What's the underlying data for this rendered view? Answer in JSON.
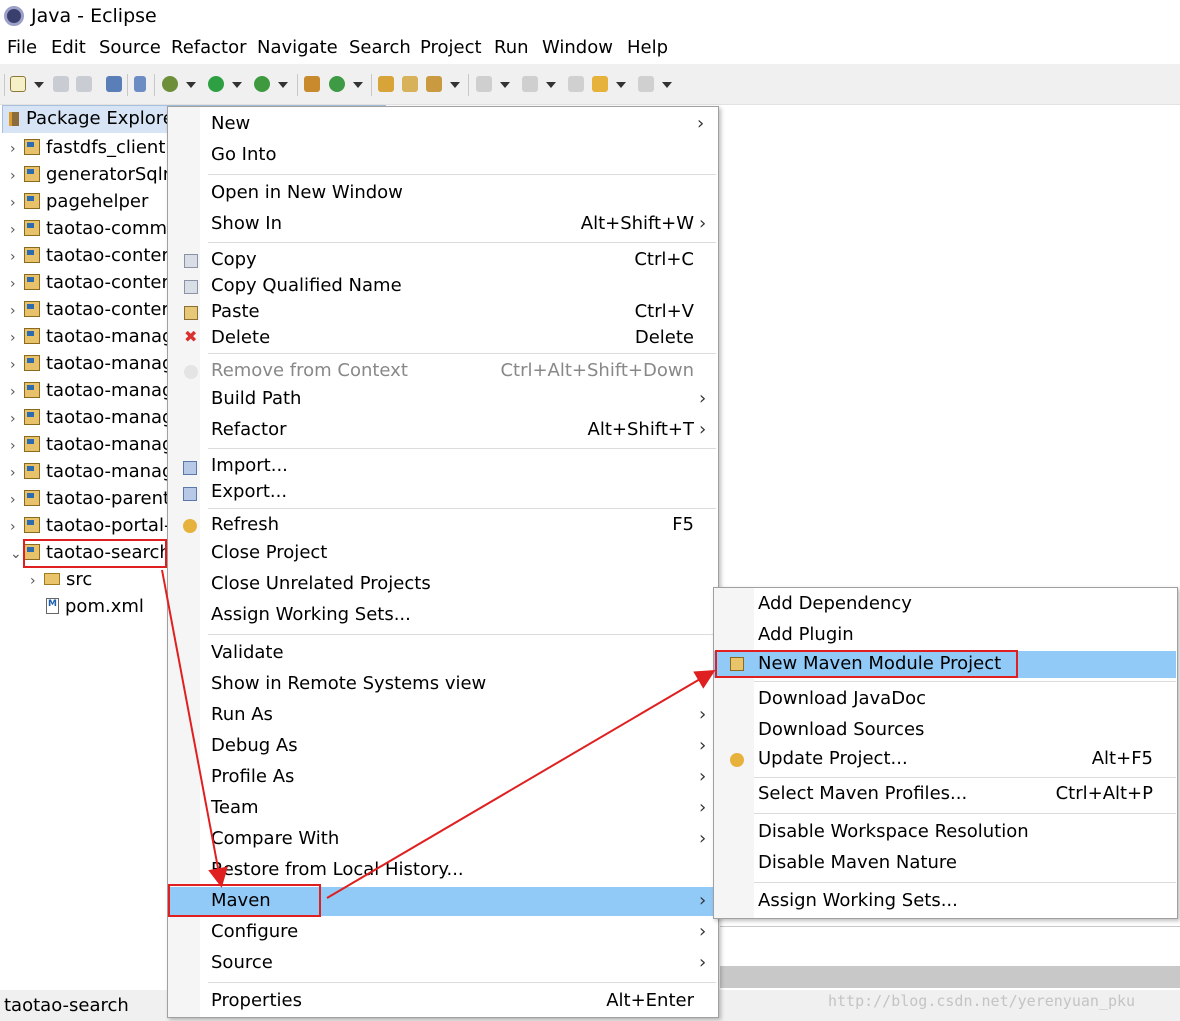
{
  "window": {
    "title": "Java - Eclipse"
  },
  "menubar": [
    "File",
    "Edit",
    "Source",
    "Refactor",
    "Navigate",
    "Search",
    "Project",
    "Run",
    "Window",
    "Help"
  ],
  "package_explorer": {
    "tab_label": "Package Explore",
    "items": [
      {
        "label": "fastdfs_client"
      },
      {
        "label": "generatorSqlm"
      },
      {
        "label": "pagehelper"
      },
      {
        "label": "taotao-comm"
      },
      {
        "label": "taotao-conter"
      },
      {
        "label": "taotao-conter"
      },
      {
        "label": "taotao-conter"
      },
      {
        "label": "taotao-manag"
      },
      {
        "label": "taotao-manag"
      },
      {
        "label": "taotao-manag"
      },
      {
        "label": "taotao-manag"
      },
      {
        "label": "taotao-manag"
      },
      {
        "label": "taotao-manag"
      },
      {
        "label": "taotao-parent"
      },
      {
        "label": "taotao-portal-"
      },
      {
        "label": "taotao-search"
      }
    ],
    "children": [
      {
        "label": "src"
      },
      {
        "label": "pom.xml"
      }
    ]
  },
  "context_menu": {
    "items": [
      {
        "label": "New",
        "shortcut": ""
      },
      {
        "label": "Go Into",
        "shortcut": ""
      },
      {
        "label": "Open in New Window",
        "shortcut": ""
      },
      {
        "label": "Show In",
        "shortcut": "Alt+Shift+W"
      },
      {
        "label": "Copy",
        "shortcut": "Ctrl+C"
      },
      {
        "label": "Copy Qualified Name",
        "shortcut": ""
      },
      {
        "label": "Paste",
        "shortcut": "Ctrl+V"
      },
      {
        "label": "Delete",
        "shortcut": "Delete"
      },
      {
        "label": "Remove from Context",
        "shortcut": "Ctrl+Alt+Shift+Down"
      },
      {
        "label": "Build Path",
        "shortcut": ""
      },
      {
        "label": "Refactor",
        "shortcut": "Alt+Shift+T"
      },
      {
        "label": "Import...",
        "shortcut": ""
      },
      {
        "label": "Export...",
        "shortcut": ""
      },
      {
        "label": "Refresh",
        "shortcut": "F5"
      },
      {
        "label": "Close Project",
        "shortcut": ""
      },
      {
        "label": "Close Unrelated Projects",
        "shortcut": ""
      },
      {
        "label": "Assign Working Sets...",
        "shortcut": ""
      },
      {
        "label": "Validate",
        "shortcut": ""
      },
      {
        "label": "Show in Remote Systems view",
        "shortcut": ""
      },
      {
        "label": "Run As",
        "shortcut": ""
      },
      {
        "label": "Debug As",
        "shortcut": ""
      },
      {
        "label": "Profile As",
        "shortcut": ""
      },
      {
        "label": "Team",
        "shortcut": ""
      },
      {
        "label": "Compare With",
        "shortcut": ""
      },
      {
        "label": "Restore from Local History...",
        "shortcut": ""
      },
      {
        "label": "Maven",
        "shortcut": ""
      },
      {
        "label": "Configure",
        "shortcut": ""
      },
      {
        "label": "Source",
        "shortcut": ""
      },
      {
        "label": "Properties",
        "shortcut": "Alt+Enter"
      }
    ]
  },
  "maven_submenu": {
    "items": [
      {
        "label": "Add Dependency",
        "shortcut": ""
      },
      {
        "label": "Add Plugin",
        "shortcut": ""
      },
      {
        "label": "New Maven Module Project",
        "shortcut": ""
      },
      {
        "label": "Download JavaDoc",
        "shortcut": ""
      },
      {
        "label": "Download Sources",
        "shortcut": ""
      },
      {
        "label": "Update Project...",
        "shortcut": "Alt+F5"
      },
      {
        "label": "Select Maven Profiles...",
        "shortcut": "Ctrl+Alt+P"
      },
      {
        "label": "Disable Workspace Resolution",
        "shortcut": ""
      },
      {
        "label": "Disable Maven Nature",
        "shortcut": ""
      },
      {
        "label": "Assign Working Sets...",
        "shortcut": ""
      }
    ]
  },
  "status": {
    "text": "taotao-search"
  },
  "watermark": "http://blog.csdn.net/yerenyuan_pku",
  "colors": {
    "highlight": "#91c9f7",
    "annotation": "#e02020"
  }
}
